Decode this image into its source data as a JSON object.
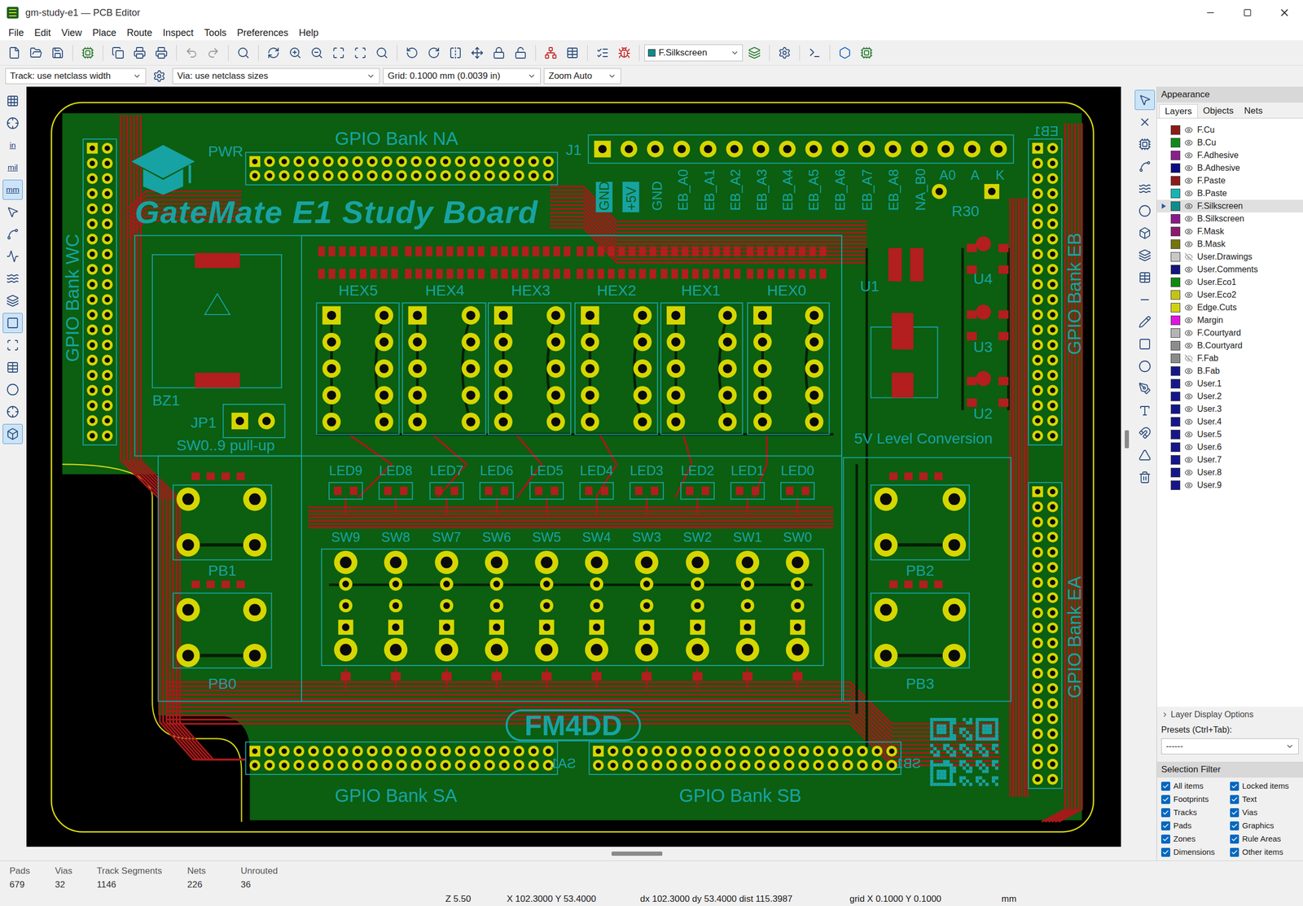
{
  "window": {
    "title": "gm-study-e1 — PCB Editor"
  },
  "menu": [
    "File",
    "Edit",
    "View",
    "Place",
    "Route",
    "Inspect",
    "Tools",
    "Preferences",
    "Help"
  ],
  "toolbar": {
    "layer_select": "F.Silkscreen"
  },
  "options_bar": {
    "track": "Track: use netclass width",
    "via": "Via: use netclass sizes",
    "grid": "Grid: 0.1000 mm (0.0039 in)",
    "zoom": "Zoom Auto"
  },
  "left_toolbar": [
    {
      "kind": "icon",
      "label": "",
      "selected": false
    },
    {
      "kind": "icon",
      "label": "",
      "selected": false
    },
    {
      "kind": "unit",
      "label": "in",
      "selected": false
    },
    {
      "kind": "unit",
      "label": "mil",
      "selected": false
    },
    {
      "kind": "unit",
      "label": "mm",
      "selected": true
    },
    {
      "kind": "icon",
      "label": "",
      "selected": false
    },
    {
      "kind": "icon",
      "label": "",
      "selected": false
    },
    {
      "kind": "icon",
      "label": "",
      "selected": false
    },
    {
      "kind": "icon",
      "label": "",
      "selected": false
    },
    {
      "kind": "icon",
      "label": "",
      "selected": false
    },
    {
      "kind": "icon",
      "label": "",
      "selected": true
    },
    {
      "kind": "icon",
      "label": "",
      "selected": false
    },
    {
      "kind": "icon",
      "label": "",
      "selected": false
    },
    {
      "kind": "icon",
      "label": "",
      "selected": false
    },
    {
      "kind": "icon",
      "label": "",
      "selected": false
    },
    {
      "kind": "icon",
      "label": "",
      "selected": true
    }
  ],
  "right_toolbar": [
    {
      "selected": true
    },
    {
      "selected": false
    },
    {
      "selected": false
    },
    {
      "selected": false
    },
    {
      "selected": false
    },
    {
      "selected": false
    },
    {
      "selected": false
    },
    {
      "selected": false
    },
    {
      "selected": false
    },
    {
      "selected": false
    },
    {
      "selected": false
    },
    {
      "selected": false
    },
    {
      "selected": false
    },
    {
      "selected": false
    },
    {
      "selected": false
    },
    {
      "selected": false
    },
    {
      "selected": false
    },
    {
      "selected": false
    }
  ],
  "board": {
    "silkscreen": [
      "GPIO Bank NA",
      "PWR",
      "J1",
      "GateMate E1 Study Board",
      "GPIO Bank WC",
      "GPIO Bank EB",
      "GPIO Bank EA",
      "GPIO Bank SA",
      "GPIO Bank SB",
      "HEX5",
      "HEX4",
      "HEX3",
      "HEX2",
      "HEX1",
      "HEX0",
      "U1",
      "R30",
      "U4",
      "U3",
      "U2",
      "5V Level Conversion",
      "BZ1",
      "JP1",
      "SW0..9 pull-up",
      "LED9",
      "LED8",
      "LED7",
      "LED6",
      "LED5",
      "LED4",
      "LED3",
      "LED2",
      "LED1",
      "LED0",
      "SW9",
      "SW8",
      "SW7",
      "SW6",
      "SW5",
      "SW4",
      "SW3",
      "SW2",
      "SW1",
      "SW0",
      "PB1",
      "PB0",
      "PB2",
      "PB3",
      "FM4DD",
      "GND",
      "+5V",
      "GND",
      "EB_A0",
      "EB_A1",
      "EB_A2",
      "EB_A3",
      "EB_A4",
      "EB_A5",
      "EB_A6",
      "EB_A7",
      "EB_A8",
      "NA_B0",
      "A0",
      "A",
      "K",
      "EB1",
      "SA1",
      "SB1"
    ]
  },
  "appearance": {
    "title": "Appearance",
    "tabs": [
      {
        "label": "Layers",
        "selected": true
      },
      {
        "label": "Objects",
        "selected": false
      },
      {
        "label": "Nets",
        "selected": false
      }
    ],
    "layers": [
      {
        "name": "F.Cu",
        "color": "#8c1a1a",
        "visible": true,
        "selected": false
      },
      {
        "name": "B.Cu",
        "color": "#0f8a1a",
        "visible": true,
        "selected": false
      },
      {
        "name": "F.Adhesive",
        "color": "#8a1f8a",
        "visible": true,
        "selected": false
      },
      {
        "name": "B.Adhesive",
        "color": "#0c0c80",
        "visible": true,
        "selected": false
      },
      {
        "name": "F.Paste",
        "color": "#8c1a1a",
        "visible": true,
        "selected": false
      },
      {
        "name": "B.Paste",
        "color": "#14b4b4",
        "visible": true,
        "selected": false
      },
      {
        "name": "F.Silkscreen",
        "color": "#0e8c8c",
        "visible": true,
        "selected": true
      },
      {
        "name": "B.Silkscreen",
        "color": "#8a1a8a",
        "visible": true,
        "selected": false
      },
      {
        "name": "F.Mask",
        "color": "#8c1a6e",
        "visible": true,
        "selected": false
      },
      {
        "name": "B.Mask",
        "color": "#747410",
        "visible": true,
        "selected": false
      },
      {
        "name": "User.Drawings",
        "color": "#c8c8c8",
        "visible": false,
        "selected": false
      },
      {
        "name": "User.Comments",
        "color": "#14147e",
        "visible": true,
        "selected": false
      },
      {
        "name": "User.Eco1",
        "color": "#0e8a0e",
        "visible": true,
        "selected": false
      },
      {
        "name": "User.Eco2",
        "color": "#c4c414",
        "visible": true,
        "selected": false
      },
      {
        "name": "Edge.Cuts",
        "color": "#d0d214",
        "visible": true,
        "selected": false
      },
      {
        "name": "Margin",
        "color": "#e014e0",
        "visible": true,
        "selected": false
      },
      {
        "name": "F.Courtyard",
        "color": "#b4b4b4",
        "visible": true,
        "selected": false
      },
      {
        "name": "B.Courtyard",
        "color": "#8c8c8c",
        "visible": true,
        "selected": false
      },
      {
        "name": "F.Fab",
        "color": "#8a8a8a",
        "visible": false,
        "selected": false
      },
      {
        "name": "B.Fab",
        "color": "#16168a",
        "visible": true,
        "selected": false
      },
      {
        "name": "User.1",
        "color": "#16168a",
        "visible": true,
        "selected": false
      },
      {
        "name": "User.2",
        "color": "#16168a",
        "visible": true,
        "selected": false
      },
      {
        "name": "User.3",
        "color": "#16168a",
        "visible": true,
        "selected": false
      },
      {
        "name": "User.4",
        "color": "#16168a",
        "visible": true,
        "selected": false
      },
      {
        "name": "User.5",
        "color": "#16168a",
        "visible": true,
        "selected": false
      },
      {
        "name": "User.6",
        "color": "#16168a",
        "visible": true,
        "selected": false
      },
      {
        "name": "User.7",
        "color": "#16168a",
        "visible": true,
        "selected": false
      },
      {
        "name": "User.8",
        "color": "#16168a",
        "visible": true,
        "selected": false
      },
      {
        "name": "User.9",
        "color": "#16168a",
        "visible": true,
        "selected": false
      }
    ],
    "display_options": "Layer Display Options",
    "presets_label": "Presets (Ctrl+Tab):",
    "preset_value": "------"
  },
  "selection_filter": {
    "title": "Selection Filter",
    "items": [
      {
        "label": "All items",
        "checked": true
      },
      {
        "label": "Locked items",
        "checked": true
      },
      {
        "label": "Footprints",
        "checked": true
      },
      {
        "label": "Text",
        "checked": true
      },
      {
        "label": "Tracks",
        "checked": true
      },
      {
        "label": "Vias",
        "checked": true
      },
      {
        "label": "Pads",
        "checked": true
      },
      {
        "label": "Graphics",
        "checked": true
      },
      {
        "label": "Zones",
        "checked": true
      },
      {
        "label": "Rule Areas",
        "checked": true
      },
      {
        "label": "Dimensions",
        "checked": true
      },
      {
        "label": "Other items",
        "checked": true
      }
    ]
  },
  "status_bar": {
    "stats": [
      {
        "label": "Pads",
        "value": "679"
      },
      {
        "label": "Vias",
        "value": "32"
      },
      {
        "label": "Track Segments",
        "value": "1146"
      },
      {
        "label": "Nets",
        "value": "226"
      },
      {
        "label": "Unrouted",
        "value": "36"
      }
    ],
    "coords": [
      "Z 5.50",
      "X 102.3000 Y 53.4000",
      "dx 102.3000 dy 53.4000 dist 115.3987",
      "grid X 0.1000 Y 0.1000",
      "mm"
    ]
  }
}
